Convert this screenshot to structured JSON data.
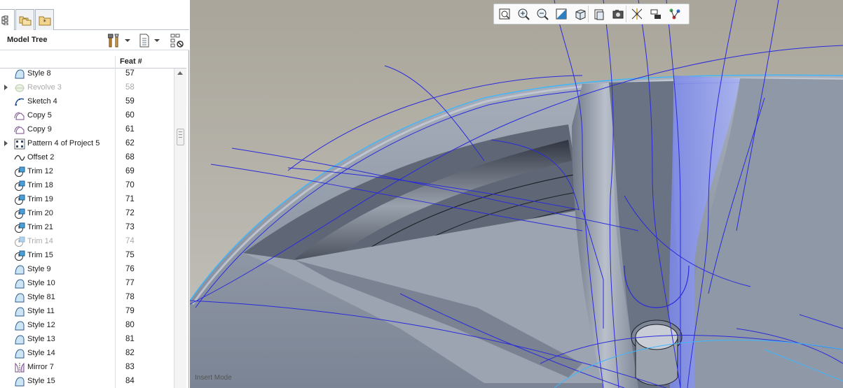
{
  "left_panel": {
    "tabs": [
      {
        "icon": "model-tree-tab-icon"
      },
      {
        "icon": "folder-browser-tab-icon"
      },
      {
        "icon": "favorites-folder-tab-icon"
      }
    ],
    "title": "Model Tree",
    "toolbar_icons": [
      "settings-tools-icon",
      "show-list-icon",
      "filter-tree-icon"
    ],
    "column_header": "Feat #",
    "rows": [
      {
        "name": "Style 8",
        "feat": "57",
        "icon": "style-icon",
        "expand": false,
        "suppressed": false
      },
      {
        "name": "Revolve 3",
        "feat": "58",
        "icon": "revolve-icon",
        "expand": true,
        "suppressed": true
      },
      {
        "name": "Sketch 4",
        "feat": "59",
        "icon": "sketch-icon",
        "expand": false,
        "suppressed": false
      },
      {
        "name": "Copy 5",
        "feat": "60",
        "icon": "copy-icon",
        "expand": false,
        "suppressed": false
      },
      {
        "name": "Copy 9",
        "feat": "61",
        "icon": "copy-icon",
        "expand": false,
        "suppressed": false
      },
      {
        "name": "Pattern 4 of Project 5",
        "feat": "62",
        "icon": "pattern-icon",
        "expand": true,
        "suppressed": false
      },
      {
        "name": "Offset 2",
        "feat": "68",
        "icon": "offset-icon",
        "expand": false,
        "suppressed": false
      },
      {
        "name": "Trim 12",
        "feat": "69",
        "icon": "trim-icon",
        "expand": false,
        "suppressed": false
      },
      {
        "name": "Trim 18",
        "feat": "70",
        "icon": "trim-icon",
        "expand": false,
        "suppressed": false
      },
      {
        "name": "Trim 19",
        "feat": "71",
        "icon": "trim-icon",
        "expand": false,
        "suppressed": false
      },
      {
        "name": "Trim 20",
        "feat": "72",
        "icon": "trim-icon",
        "expand": false,
        "suppressed": false
      },
      {
        "name": "Trim 21",
        "feat": "73",
        "icon": "trim-icon",
        "expand": false,
        "suppressed": false
      },
      {
        "name": "Trim 14",
        "feat": "74",
        "icon": "trim-icon",
        "expand": false,
        "suppressed": true
      },
      {
        "name": "Trim 15",
        "feat": "75",
        "icon": "trim-icon",
        "expand": false,
        "suppressed": false
      },
      {
        "name": "Style 9",
        "feat": "76",
        "icon": "style-icon",
        "expand": false,
        "suppressed": false
      },
      {
        "name": "Style 10",
        "feat": "77",
        "icon": "style-icon",
        "expand": false,
        "suppressed": false
      },
      {
        "name": "Style 81",
        "feat": "78",
        "icon": "style-icon",
        "expand": false,
        "suppressed": false
      },
      {
        "name": "Style 11",
        "feat": "79",
        "icon": "style-icon",
        "expand": false,
        "suppressed": false
      },
      {
        "name": "Style 12",
        "feat": "80",
        "icon": "style-icon",
        "expand": false,
        "suppressed": false
      },
      {
        "name": "Style 13",
        "feat": "81",
        "icon": "style-icon",
        "expand": false,
        "suppressed": false
      },
      {
        "name": "Style 14",
        "feat": "82",
        "icon": "style-icon",
        "expand": false,
        "suppressed": false
      },
      {
        "name": "Mirror 7",
        "feat": "83",
        "icon": "mirror-icon",
        "expand": false,
        "suppressed": false
      },
      {
        "name": "Style 15",
        "feat": "84",
        "icon": "style-icon",
        "expand": false,
        "suppressed": false
      }
    ]
  },
  "viewport": {
    "toolbar": [
      "refit-icon",
      "zoom-in-icon",
      "zoom-out-icon",
      "repaint-icon",
      "display-style-icon",
      "saved-views-icon",
      "view-manager-icon",
      "datum-display-icon",
      "annotation-display-icon",
      "spin-center-icon"
    ],
    "mode_label": "Insert Mode",
    "colors": {
      "background_top": "#a9a59a",
      "background_bottom": "#c4c3bd",
      "surface": "#8e97a6",
      "curve": "#2a2adc",
      "highlight": "#3db7ff",
      "selection": "#8c96ea"
    }
  }
}
